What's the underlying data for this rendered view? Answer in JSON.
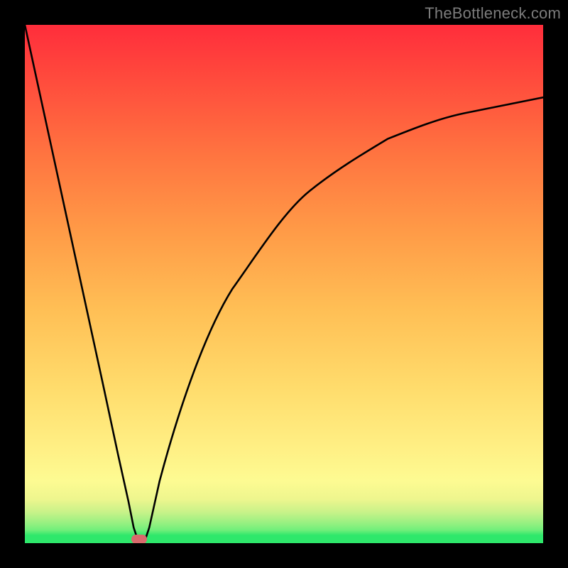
{
  "watermark": "TheBottleneck.com",
  "chart_data": {
    "type": "line",
    "title": "",
    "xlabel": "",
    "ylabel": "",
    "xlim": [
      0,
      100
    ],
    "ylim": [
      0,
      100
    ],
    "grid": false,
    "legend": false,
    "series": [
      {
        "name": "curve",
        "x": [
          0,
          5,
          10,
          15,
          18,
          20,
          21,
          22,
          23,
          24,
          26,
          30,
          35,
          40,
          45,
          50,
          55,
          60,
          65,
          70,
          75,
          80,
          85,
          90,
          95,
          100
        ],
        "y": [
          100,
          77,
          54,
          31,
          17,
          8,
          3,
          0,
          0,
          3,
          12,
          27,
          41,
          51,
          58,
          64,
          69,
          73,
          76,
          78,
          80,
          82,
          83,
          84,
          85,
          86
        ]
      }
    ],
    "marker": {
      "x_min": 21,
      "x_max": 23,
      "y": 0,
      "color": "#d96a6c"
    },
    "background_bands": [
      {
        "ylo": 0,
        "yhi": 2.5,
        "color": "#2ee86b"
      },
      {
        "ylo": 2.5,
        "yhi": 5,
        "color": "#6fef7a"
      },
      {
        "ylo": 5,
        "yhi": 8,
        "color": "#aef083"
      },
      {
        "ylo": 8,
        "yhi": 12,
        "color": "#d8f48c"
      },
      {
        "ylo": 12,
        "yhi": 18,
        "color": "#f6f58e"
      },
      {
        "ylo": 18,
        "yhi": 100,
        "gradient": [
          "#fff085",
          "#ffd060",
          "#ffa446",
          "#ff6b3f",
          "#ff2f3c"
        ]
      }
    ]
  }
}
